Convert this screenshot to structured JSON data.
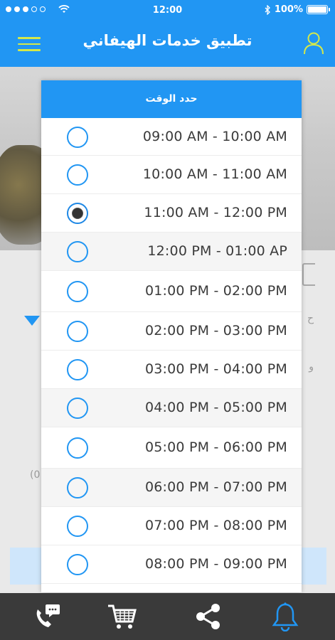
{
  "status_bar": {
    "time": "12:00",
    "battery": "100%",
    "signal_icon": "signal-dots-icon",
    "wifi_icon": "wifi-icon",
    "bluetooth_icon": "bluetooth-icon"
  },
  "header": {
    "title": "تطبيق خدمات الهيفاني",
    "menu_icon": "hamburger-menu-icon",
    "user_icon": "user-profile-icon"
  },
  "background": {
    "left_text_1": "(0",
    "right_text_1": "ح",
    "right_text_2": "و"
  },
  "modal": {
    "title": "حدد الوقت",
    "slots": [
      {
        "label": "09:00 AM - 10:00 AM",
        "selected": false
      },
      {
        "label": "10:00 AM - 11:00 AM",
        "selected": false
      },
      {
        "label": "11:00 AM - 12:00 PM",
        "selected": true
      },
      {
        "label": "12:00 PM - 01:00 AP",
        "selected": false
      },
      {
        "label": "01:00 PM - 02:00 PM",
        "selected": false
      },
      {
        "label": "02:00 PM - 03:00 PM",
        "selected": false
      },
      {
        "label": "03:00 PM - 04:00 PM",
        "selected": false
      },
      {
        "label": "04:00 PM - 05:00 PM",
        "selected": false
      },
      {
        "label": "05:00 PM - 06:00 PM",
        "selected": false
      },
      {
        "label": "06:00 PM - 07:00 PM",
        "selected": false
      },
      {
        "label": "07:00 PM - 08:00 PM",
        "selected": false
      },
      {
        "label": "08:00 PM - 09:00 PM",
        "selected": false
      }
    ]
  },
  "bottom_nav": {
    "items": [
      {
        "icon": "phone-chat-icon"
      },
      {
        "icon": "shopping-cart-icon"
      },
      {
        "icon": "share-icon"
      },
      {
        "icon": "bell-notification-icon"
      }
    ]
  },
  "colors": {
    "primary": "#2196f3",
    "bottom_bar": "#3a3a3a",
    "bell_accent": "#2196f3"
  }
}
